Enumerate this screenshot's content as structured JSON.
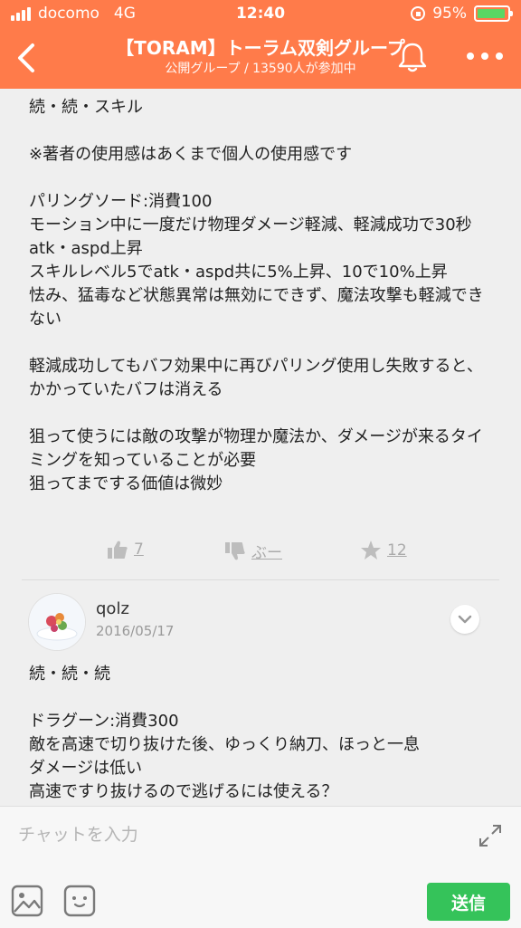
{
  "status_bar": {
    "carrier": "docomo",
    "network": "4G",
    "time": "12:40",
    "battery": "95%",
    "battery_level": 0.95
  },
  "nav": {
    "title": "【TORAM】トーラム双剣グループ",
    "subtitle": "公開グループ / 13590人が参加中"
  },
  "post": {
    "body": "続・続・スキル\n\n※著者の使用感はあくまで個人の使用感です\n\nパリングソード:消費100\nモーション中に一度だけ物理ダメージ軽減、軽減成功で30秒atk・aspd上昇\nスキルレベル5でatk・aspd共に5%上昇、10で10%上昇\n怯み、猛毒など状態異常は無効にできず、魔法攻撃も軽減できない\n\n軽減成功してもバフ効果中に再びパリング使用し失敗すると、かかっていたバフは消える\n\n狙って使うには敵の攻撃が物理か魔法か、ダメージが来るタイミングを知っていることが必要\n狙ってまでする価値は微妙",
    "likes": "7",
    "boo": "ぶー",
    "stars": "12"
  },
  "comment": {
    "user": "qolz",
    "date": "2016/05/17",
    "body": "続・続・続\n\nドラグーン:消費300\n敵を高速で切り抜けた後、ゆっくり納刀、ほっと一息\nダメージは低い\n高速ですり抜けるので逃げるには使える？"
  },
  "input": {
    "placeholder": "チャットを入力",
    "send_label": "送信"
  },
  "colors": {
    "header": "#ff7b4a",
    "send": "#35c35a",
    "background": "#efefef"
  }
}
